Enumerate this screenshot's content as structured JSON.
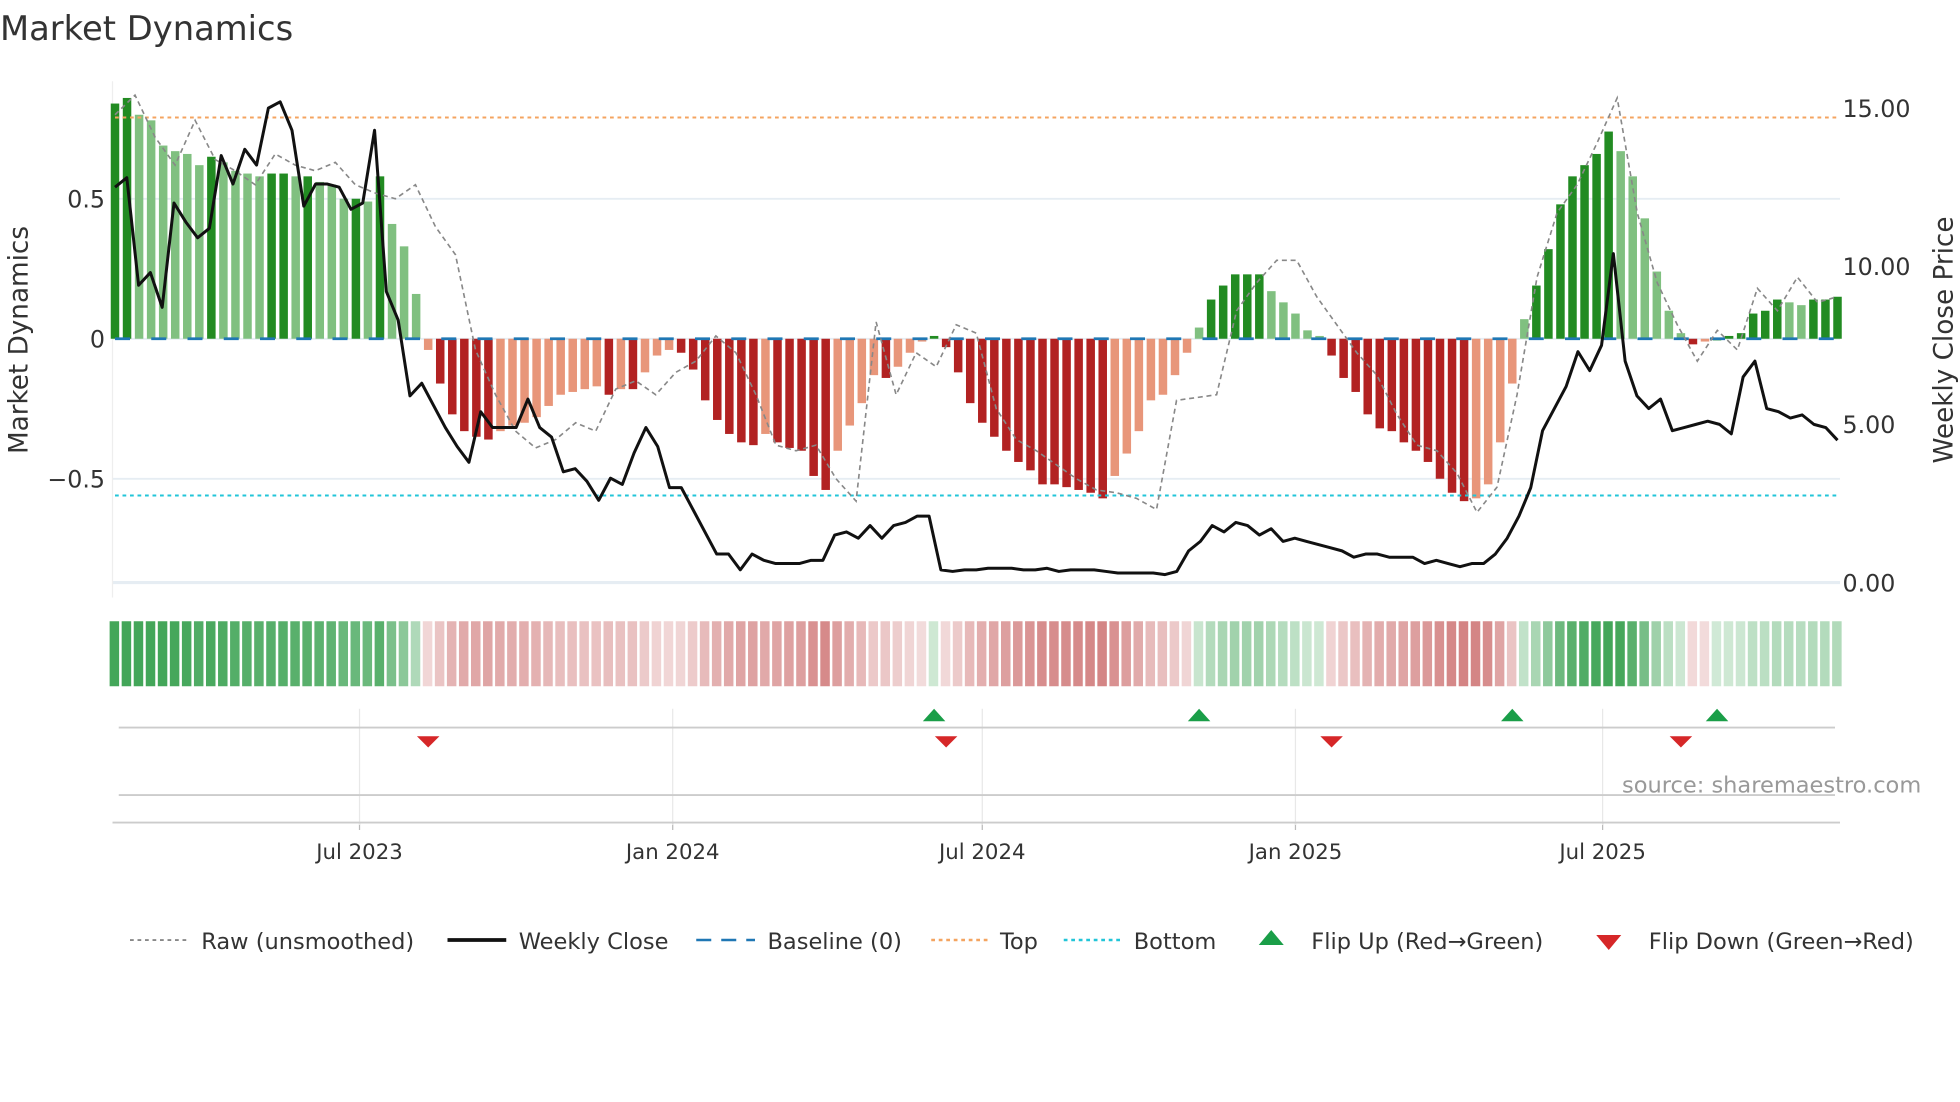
{
  "title": "Market Dynamics",
  "source": "source: sharemaestro.com",
  "colors": {
    "green_strong": "#228b22",
    "green_weak": "#80c080",
    "red_strong": "#b22222",
    "red_weak": "#e8967a",
    "top": "#f4a460",
    "bottom": "#22c5d8",
    "baseline": "#1f77b4",
    "flip_up": "#1a9e48",
    "flip_down": "#d62728"
  },
  "chart_data": {
    "type": "bar",
    "title": "Market Dynamics",
    "ylabel": "Market Dynamics",
    "y2label": "Weekly Close Price",
    "ylim": [
      -0.87,
      0.92
    ],
    "y2lim": [
      0,
      16.5
    ],
    "yticks": [
      {
        "v": 0.5,
        "label": "0.5"
      },
      {
        "v": 0,
        "label": "0"
      },
      {
        "v": -0.5,
        "label": "−0.5"
      }
    ],
    "y2ticks": [
      {
        "v": 15,
        "label": "15.00"
      },
      {
        "v": 10,
        "label": "10.00"
      },
      {
        "v": 5,
        "label": "5.00"
      },
      {
        "v": 0,
        "label": "0.00"
      }
    ],
    "xticks": [
      {
        "week": 20.3,
        "label": "Jul 2023"
      },
      {
        "week": 46.3,
        "label": "Jan 2024"
      },
      {
        "week": 72,
        "label": "Jul 2024"
      },
      {
        "week": 98,
        "label": "Jan 2025"
      },
      {
        "week": 123.5,
        "label": "Jul 2025"
      }
    ],
    "top": 0.79,
    "bottom": -0.56,
    "baseline": 0,
    "momentum": [
      0.84,
      0.86,
      0.8,
      0.78,
      0.69,
      0.67,
      0.66,
      0.62,
      0.65,
      0.63,
      0.6,
      0.59,
      0.58,
      0.59,
      0.59,
      0.58,
      0.58,
      0.56,
      0.55,
      0.5,
      0.5,
      0.49,
      0.58,
      0.41,
      0.33,
      0.16,
      -0.04,
      -0.16,
      -0.27,
      -0.33,
      -0.35,
      -0.36,
      -0.33,
      -0.31,
      -0.3,
      -0.28,
      -0.24,
      -0.2,
      -0.19,
      -0.18,
      -0.17,
      -0.2,
      -0.18,
      -0.18,
      -0.12,
      -0.06,
      -0.04,
      -0.05,
      -0.11,
      -0.22,
      -0.29,
      -0.34,
      -0.37,
      -0.38,
      -0.34,
      -0.37,
      -0.39,
      -0.4,
      -0.49,
      -0.54,
      -0.4,
      -0.31,
      -0.23,
      -0.13,
      -0.14,
      -0.1,
      -0.05,
      -0.01,
      0.01,
      -0.03,
      -0.12,
      -0.23,
      -0.3,
      -0.35,
      -0.4,
      -0.44,
      -0.47,
      -0.52,
      -0.52,
      -0.53,
      -0.54,
      -0.55,
      -0.57,
      -0.49,
      -0.41,
      -0.33,
      -0.22,
      -0.2,
      -0.13,
      -0.05,
      0.04,
      0.14,
      0.19,
      0.23,
      0.23,
      0.23,
      0.17,
      0.13,
      0.09,
      0.03,
      0.01,
      -0.06,
      -0.14,
      -0.19,
      -0.27,
      -0.32,
      -0.33,
      -0.37,
      -0.4,
      -0.44,
      -0.5,
      -0.55,
      -0.58,
      -0.57,
      -0.52,
      -0.37,
      -0.16,
      0.07,
      0.19,
      0.32,
      0.48,
      0.58,
      0.62,
      0.66,
      0.74,
      0.67,
      0.58,
      0.43,
      0.24,
      0.1,
      0.02,
      -0.02,
      -0.01,
      0.0,
      0.01,
      0.02,
      0.09,
      0.1,
      0.14,
      0.13,
      0.12,
      0.14,
      0.14,
      0.15
    ],
    "raw": [
      0.8,
      0.87,
      0.72,
      0.62,
      0.78,
      0.64,
      0.6,
      0.55,
      0.66,
      0.62,
      0.6,
      0.63,
      0.55,
      0.52,
      0.5,
      0.55,
      0.4,
      0.3,
      -0.04,
      -0.2,
      -0.33,
      -0.39,
      -0.36,
      -0.3,
      -0.33,
      -0.18,
      -0.15,
      -0.2,
      -0.12,
      -0.08,
      0.01,
      -0.05,
      -0.2,
      -0.38,
      -0.4,
      -0.38,
      -0.5,
      -0.58,
      0.06,
      -0.2,
      -0.05,
      -0.1,
      0.05,
      0.02,
      -0.25,
      -0.36,
      -0.4,
      -0.45,
      -0.5,
      -0.54,
      -0.55,
      -0.57,
      -0.61,
      -0.22,
      -0.21,
      -0.2,
      0.1,
      0.2,
      0.28,
      0.28,
      0.15,
      0.05,
      -0.05,
      -0.13,
      -0.27,
      -0.38,
      -0.4,
      -0.48,
      -0.62,
      -0.53,
      -0.2,
      0.22,
      0.45,
      0.55,
      0.7,
      0.86,
      0.45,
      0.2,
      0.05,
      -0.08,
      0.03,
      -0.04,
      0.18,
      0.1,
      0.22,
      0.13,
      0.15
    ],
    "close": [
      12.5,
      12.8,
      9.4,
      9.8,
      8.7,
      12.0,
      11.4,
      10.9,
      11.2,
      13.5,
      12.6,
      13.7,
      13.2,
      15.0,
      15.2,
      14.3,
      11.9,
      12.6,
      12.6,
      12.5,
      11.8,
      12.0,
      14.3,
      9.2,
      8.3,
      5.9,
      6.3,
      5.6,
      4.9,
      4.3,
      3.8,
      5.4,
      4.9,
      4.9,
      4.9,
      5.8,
      4.9,
      4.6,
      3.5,
      3.6,
      3.2,
      2.6,
      3.3,
      3.1,
      4.1,
      4.9,
      4.3,
      3.0,
      3.0,
      2.3,
      1.6,
      0.9,
      0.9,
      0.4,
      0.9,
      0.7,
      0.6,
      0.6,
      0.6,
      0.7,
      0.7,
      1.5,
      1.6,
      1.4,
      1.8,
      1.4,
      1.8,
      1.9,
      2.1,
      2.1,
      0.4,
      0.35,
      0.4,
      0.4,
      0.45,
      0.45,
      0.45,
      0.4,
      0.4,
      0.45,
      0.35,
      0.4,
      0.4,
      0.4,
      0.35,
      0.3,
      0.3,
      0.3,
      0.3,
      0.25,
      0.35,
      1.0,
      1.3,
      1.8,
      1.6,
      1.9,
      1.8,
      1.5,
      1.7,
      1.3,
      1.4,
      1.3,
      1.2,
      1.1,
      1.0,
      0.8,
      0.9,
      0.9,
      0.8,
      0.8,
      0.8,
      0.6,
      0.7,
      0.6,
      0.5,
      0.6,
      0.6,
      0.9,
      1.4,
      2.1,
      3.0,
      4.8,
      5.5,
      6.2,
      7.3,
      6.7,
      7.5,
      10.4,
      7.0,
      5.9,
      5.5,
      5.8,
      4.8,
      4.9,
      5.0,
      5.1,
      5.0,
      4.7,
      6.5,
      7.0,
      5.5,
      5.4,
      5.2,
      5.3,
      5.0,
      4.9,
      4.5
    ],
    "flips_up_weeks": [
      68,
      90,
      116,
      133
    ],
    "flips_down_weeks": [
      26,
      69,
      101,
      130
    ]
  },
  "legend": {
    "raw": "Raw (unsmoothed)",
    "close": "Weekly Close",
    "baseline": "Baseline (0)",
    "top": "Top",
    "bottom": "Bottom",
    "flip_up": "Flip Up (Red→Green)",
    "flip_down": "Flip Down (Green→Red)"
  }
}
